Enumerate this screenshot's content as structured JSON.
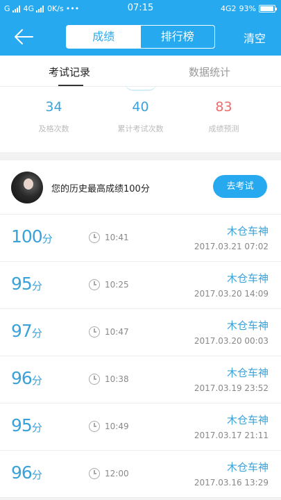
{
  "status_bar": {
    "carrier": "G",
    "network": "4G",
    "speed": "0K/s",
    "dots": "•••",
    "time": "07:15",
    "right_network": "4G2",
    "battery_percent": "93%",
    "battery_level": 0.93
  },
  "nav": {
    "segments": [
      "成绩",
      "排行榜"
    ],
    "active_segment": 0,
    "clear_label": "清空"
  },
  "subtabs": [
    "考试记录",
    "数据统计"
  ],
  "stats": [
    {
      "value": "34",
      "label": "及格次数",
      "color": "#3aa2d9"
    },
    {
      "value": "40",
      "label": "累计考试次数",
      "color": "#3aa2d9"
    },
    {
      "value": "83",
      "label": "成绩预测",
      "color": "#ef6a6a"
    }
  ],
  "best": {
    "text": "您的历史最高成绩100分",
    "button": "去考试"
  },
  "score_unit": "分",
  "records": [
    {
      "score": "100",
      "duration": "10:41",
      "name": "木仓车神",
      "date": "2017.03.21  07:02"
    },
    {
      "score": "95",
      "duration": "10:25",
      "name": "木仓车神",
      "date": "2017.03.20  14:09"
    },
    {
      "score": "97",
      "duration": "10:47",
      "name": "木仓车神",
      "date": "2017.03.20  00:03"
    },
    {
      "score": "96",
      "duration": "10:38",
      "name": "木仓车神",
      "date": "2017.03.19  23:52"
    },
    {
      "score": "95",
      "duration": "10:49",
      "name": "木仓车神",
      "date": "2017.03.17  21:11"
    },
    {
      "score": "96",
      "duration": "12:00",
      "name": "木仓车神",
      "date": "2017.03.16  13:29"
    }
  ]
}
